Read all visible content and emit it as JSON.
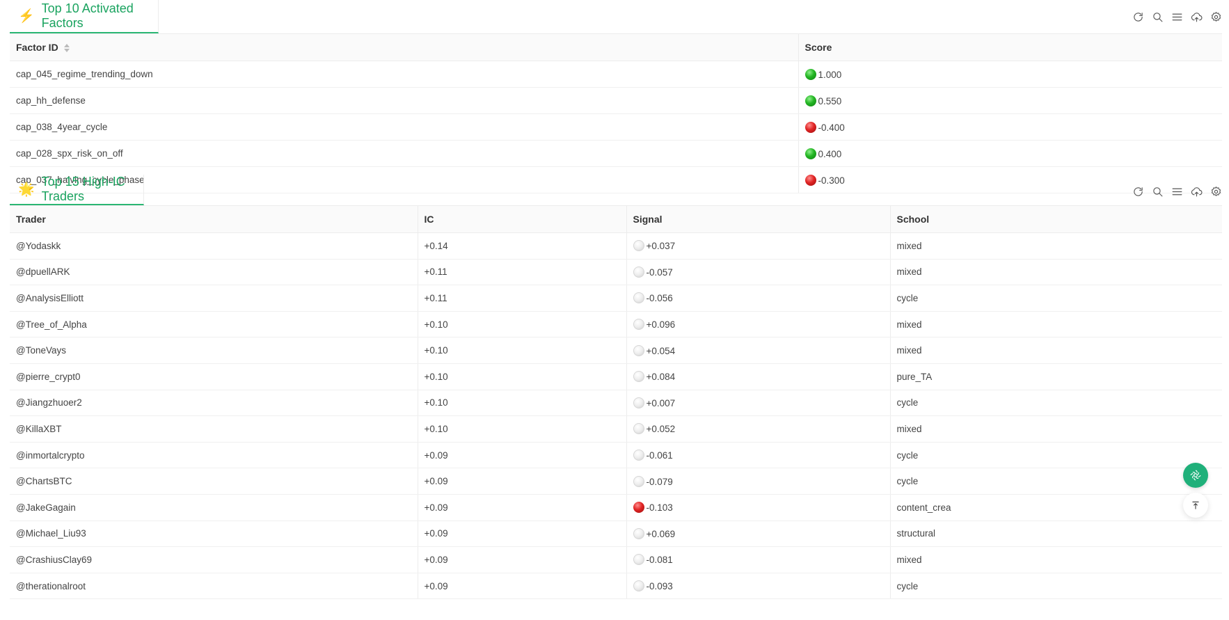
{
  "factors_panel": {
    "emoji": "⚡",
    "title": "Top 10 Activated Factors",
    "columns": [
      "Factor ID",
      "Score"
    ],
    "rows": [
      {
        "factor_id": "cap_045_regime_trending_down",
        "status": "green",
        "score": "1.000"
      },
      {
        "factor_id": "cap_hh_defense",
        "status": "green",
        "score": "0.550"
      },
      {
        "factor_id": "cap_038_4year_cycle",
        "status": "red",
        "score": "-0.400"
      },
      {
        "factor_id": "cap_028_spx_risk_on_off",
        "status": "green",
        "score": "0.400"
      },
      {
        "factor_id": "cap_037_halving_cycle_phase",
        "status": "red",
        "score": "-0.300"
      }
    ]
  },
  "traders_panel": {
    "emoji": "🌟",
    "title": "Top 15 High-IC Traders",
    "columns": [
      "Trader",
      "IC",
      "Signal",
      "School"
    ],
    "rows": [
      {
        "trader": "@Yodaskk",
        "ic": "+0.14",
        "status": "white",
        "signal": "+0.037",
        "school": "mixed"
      },
      {
        "trader": "@dpuellARK",
        "ic": "+0.11",
        "status": "white",
        "signal": "-0.057",
        "school": "mixed"
      },
      {
        "trader": "@AnalysisElliott",
        "ic": "+0.11",
        "status": "white",
        "signal": "-0.056",
        "school": "cycle"
      },
      {
        "trader": "@Tree_of_Alpha",
        "ic": "+0.10",
        "status": "white",
        "signal": "+0.096",
        "school": "mixed"
      },
      {
        "trader": "@ToneVays",
        "ic": "+0.10",
        "status": "white",
        "signal": "+0.054",
        "school": "mixed"
      },
      {
        "trader": "@pierre_crypt0",
        "ic": "+0.10",
        "status": "white",
        "signal": "+0.084",
        "school": "pure_TA"
      },
      {
        "trader": "@Jiangzhuoer2",
        "ic": "+0.10",
        "status": "white",
        "signal": "+0.007",
        "school": "cycle"
      },
      {
        "trader": "@KillaXBT",
        "ic": "+0.10",
        "status": "white",
        "signal": "+0.052",
        "school": "mixed"
      },
      {
        "trader": "@inmortalcrypto",
        "ic": "+0.09",
        "status": "white",
        "signal": "-0.061",
        "school": "cycle"
      },
      {
        "trader": "@ChartsBTC",
        "ic": "+0.09",
        "status": "white",
        "signal": "-0.079",
        "school": "cycle"
      },
      {
        "trader": "@JakeGagain",
        "ic": "+0.09",
        "status": "red",
        "signal": "-0.103",
        "school": "content_crea"
      },
      {
        "trader": "@Michael_Liu93",
        "ic": "+0.09",
        "status": "white",
        "signal": "+0.069",
        "school": "structural"
      },
      {
        "trader": "@CrashiusClay69",
        "ic": "+0.09",
        "status": "white",
        "signal": "-0.081",
        "school": "mixed"
      },
      {
        "trader": "@therationalroot",
        "ic": "+0.09",
        "status": "white",
        "signal": "-0.093",
        "school": "cycle"
      }
    ]
  },
  "toolbar_icons": [
    "refresh-icon",
    "search-icon",
    "menu-icon",
    "cloud-upload-icon",
    "settings-icon"
  ],
  "floating": {
    "ai_icon": "ai-assistant-icon",
    "top_icon": "back-to-top-icon"
  },
  "colors": {
    "accent": "#1aa35f",
    "tab_underline": "#2bb673",
    "fab": "#1fb07a"
  }
}
